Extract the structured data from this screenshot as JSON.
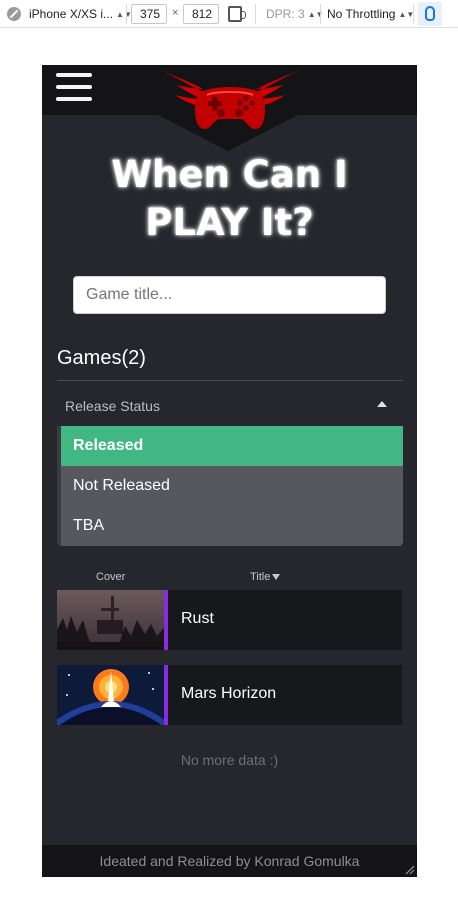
{
  "devtools": {
    "device": "iPhone X/XS i...",
    "width": "375",
    "times": "×",
    "height": "812",
    "dpr": "DPR: 3",
    "throttling": "No Throttling"
  },
  "site": {
    "title_line1": "When Can I",
    "title_line2": "PLAY It?",
    "search_placeholder": "Game title...",
    "games_heading": "Games(2)",
    "release_filter_label": "Release Status",
    "options": [
      "Released",
      "Not Released",
      "TBA"
    ],
    "selected_option": "Released",
    "columns": {
      "cover": "Cover",
      "title": "Title"
    },
    "games": [
      {
        "title": "Rust"
      },
      {
        "title": "Mars Horizon"
      }
    ],
    "no_more": "No more data :)",
    "footer": "Ideated and Realized by Konrad Gomulka"
  },
  "colors": {
    "page_bg": "#25272d",
    "bar_bg": "#141416",
    "selected_option": "#41b883",
    "row_accent": "#8a2be2",
    "logo_red": "#d40000"
  }
}
